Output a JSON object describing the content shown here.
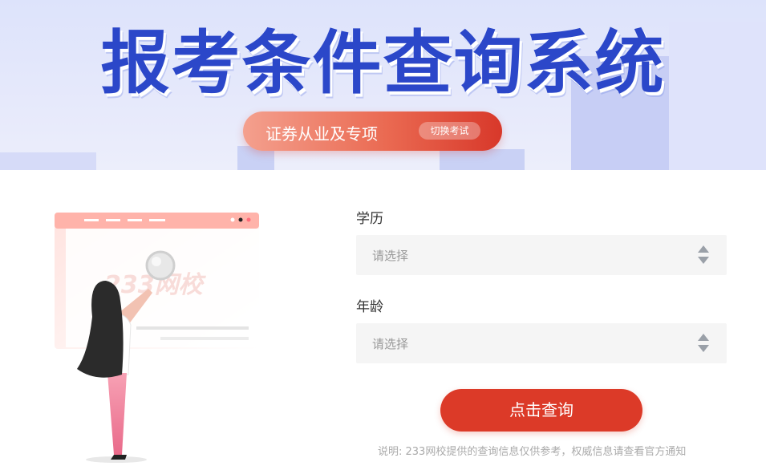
{
  "banner": {
    "title": "报考条件查询系统",
    "exam_name": "证券从业及专项",
    "switch_label": "切换考试"
  },
  "illustration": {
    "watermark": "233网校"
  },
  "form": {
    "education": {
      "label": "学历",
      "placeholder": "请选择"
    },
    "age": {
      "label": "年龄",
      "placeholder": "请选择"
    }
  },
  "query_button_label": "点击查询",
  "note": "说明: 233网校提供的查询信息仅供参考，权威信息请查看官方通知",
  "colors": {
    "brand_blue": "#2b47c9",
    "accent_red": "#dc3a28",
    "banner_bg": "#e2e6fb"
  }
}
